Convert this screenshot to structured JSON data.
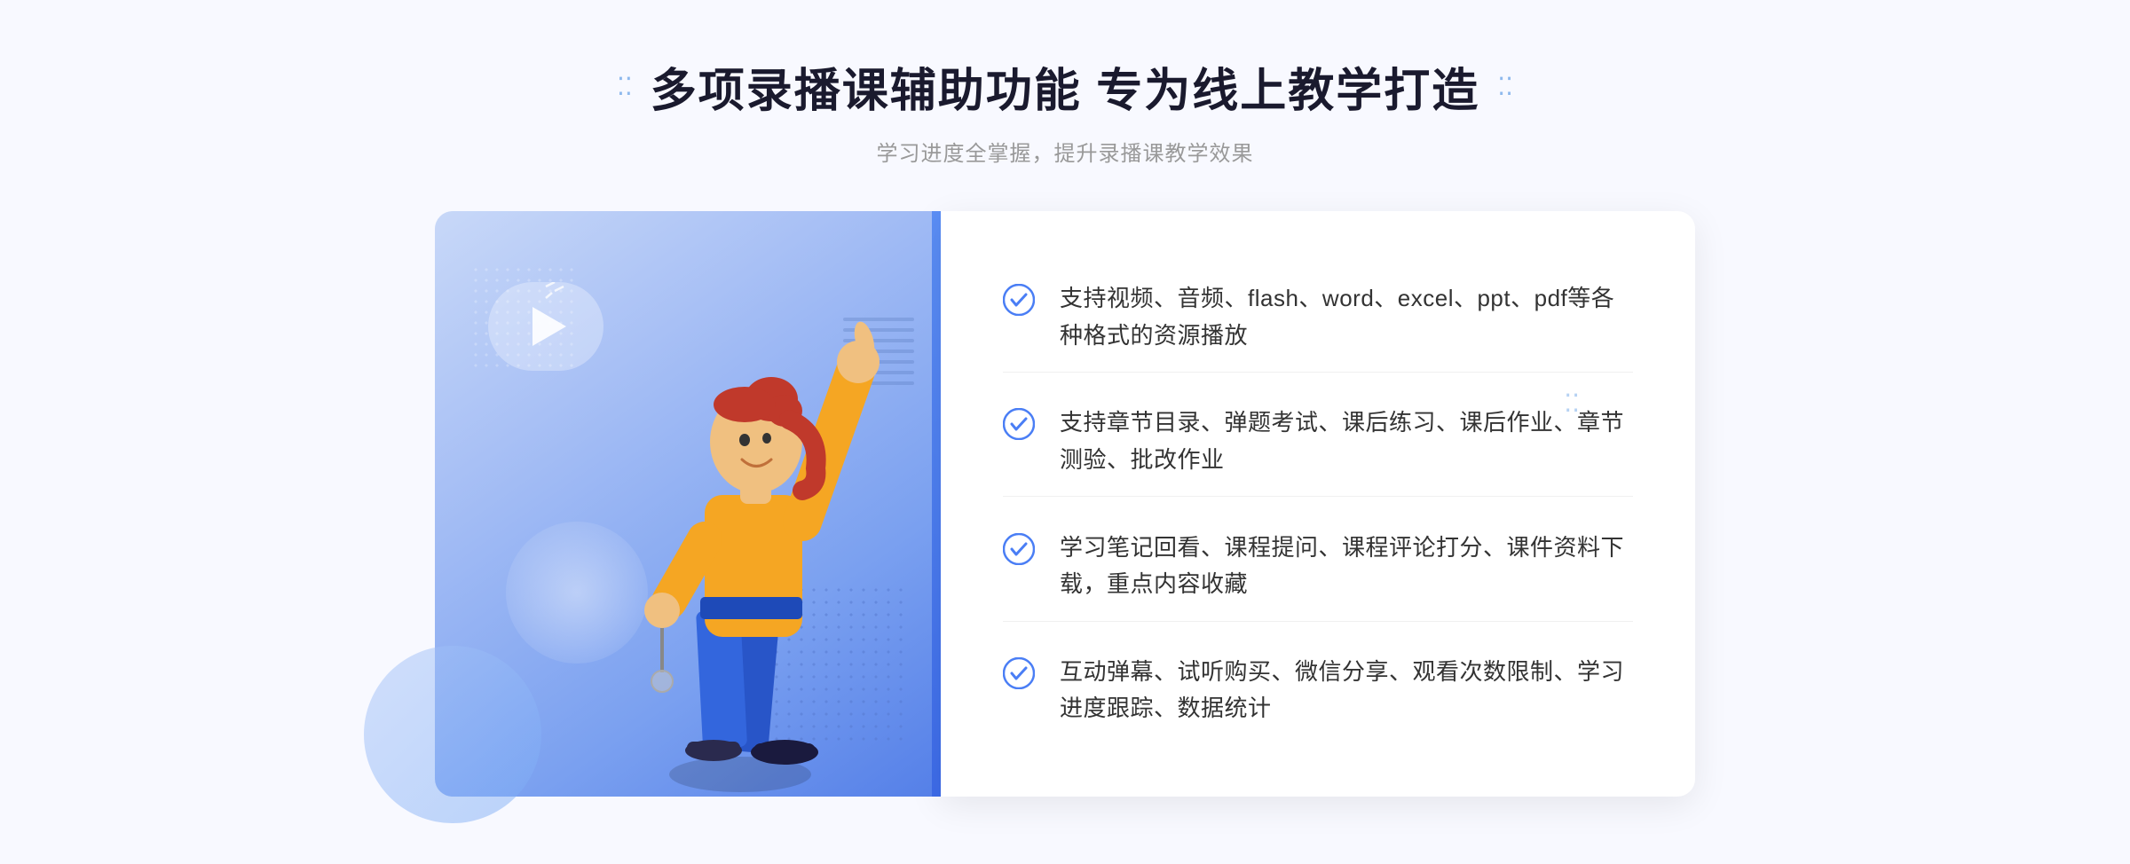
{
  "header": {
    "title": "多项录播课辅助功能 专为线上教学打造",
    "subtitle": "学习进度全掌握，提升录播课教学效果",
    "decorDots": "⁚⁚",
    "decorDotsRight": "⁚⁚"
  },
  "features": [
    {
      "id": 1,
      "text": "支持视频、音频、flash、word、excel、ppt、pdf等各种格式的资源播放"
    },
    {
      "id": 2,
      "text": "支持章节目录、弹题考试、课后练习、课后作业、章节测验、批改作业"
    },
    {
      "id": 3,
      "text": "学习笔记回看、课程提问、课程评论打分、课件资料下载，重点内容收藏"
    },
    {
      "id": 4,
      "text": "互动弹幕、试听购买、微信分享、观看次数限制、学习进度跟踪、数据统计"
    }
  ],
  "leftArrows": "»",
  "rightDots": "⁚⁚",
  "colors": {
    "primary": "#4a7ef5",
    "gradient_start": "#c8d8f8",
    "gradient_end": "#5580e8",
    "text_dark": "#1a1a2e",
    "text_gray": "#999",
    "check_color": "#4a7ef5"
  }
}
